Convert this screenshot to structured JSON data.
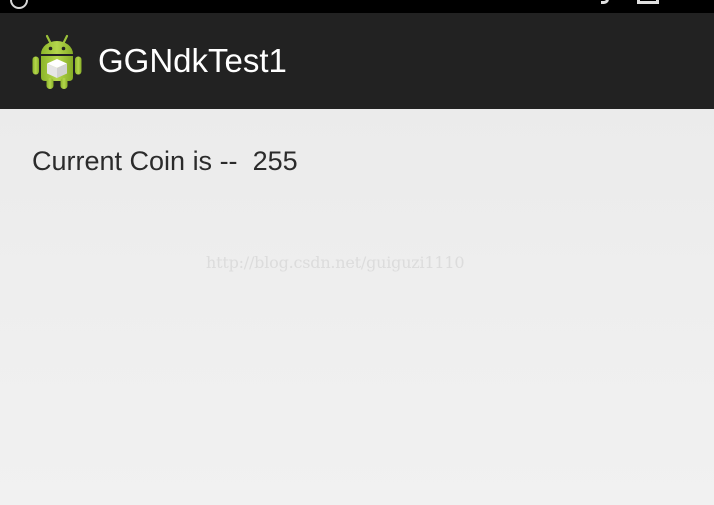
{
  "action_bar": {
    "title": "GGNdkTest1",
    "icon": "android-robot-icon",
    "background": "#222222"
  },
  "content": {
    "coin_label": "Current Coin is --",
    "coin_value": "255"
  },
  "watermark": {
    "text": "http://blog.csdn.net/guiguzi1110"
  },
  "colors": {
    "status_bar": "#000000",
    "window_background": "#efefef",
    "android_green": "#a4c639"
  }
}
